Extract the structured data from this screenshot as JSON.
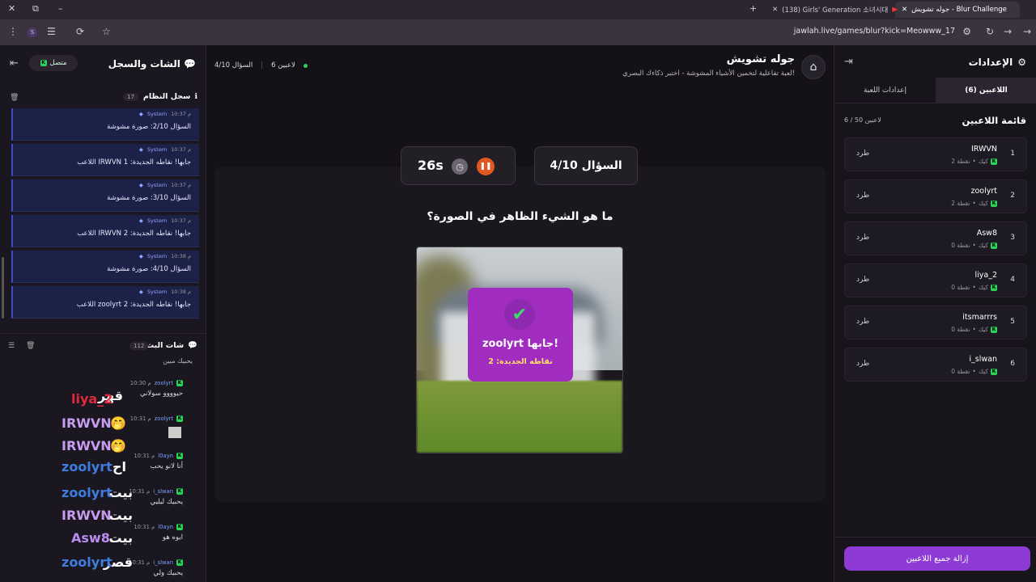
{
  "browser": {
    "tabs": [
      {
        "label": "جوله تشويش - Blur Challenge",
        "active": true
      },
      {
        "label": "(138) Girls' Generation 소녀시대",
        "active": false
      }
    ],
    "url": "jawlah.live/games/blur?kick=Meowww_17"
  },
  "settings_panel": {
    "title": "الإعدادات",
    "tabs": [
      "اللاعبين (6)",
      "إعدادات اللعبة"
    ],
    "players_title": "قائمة اللاعبين",
    "players_count": "6 / 50 لاعبين",
    "platform_label": "كيك",
    "kick_label": "طرد",
    "players": [
      {
        "rank": "1",
        "name": "IRWVN",
        "points": "2 نقطة"
      },
      {
        "rank": "2",
        "name": "zoolyrt",
        "points": "2 نقطة"
      },
      {
        "rank": "3",
        "name": "Asw8",
        "points": "0 نقطة"
      },
      {
        "rank": "4",
        "name": "liya_2",
        "points": "0 نقطة"
      },
      {
        "rank": "5",
        "name": "itsmarrrs",
        "points": "0 نقطة"
      },
      {
        "rank": "6",
        "name": "i_slwan",
        "points": "0 نقطة"
      }
    ],
    "clear_button": "إزالة جميع اللاعبين"
  },
  "game": {
    "title": "جوله تشويش",
    "subtitle": "لعبة تفاعلية لتخمين الأشياء المشوشة - اختبر ذكاءك البصري!",
    "players_online": "6 لاعبين",
    "question_short": "السؤال 4/10",
    "question_box": "السؤال 4/10",
    "timer": "26s",
    "question_text": "ما هو الشيء الظاهر في الصورة؟",
    "overlay_title": "zoolyrt جابها!",
    "overlay_sub": "نقاطه الجديدة: 2"
  },
  "chat_panel": {
    "title": "الشات والسجل",
    "status": "متصل",
    "system_log": {
      "title": "سجل النظام",
      "count": "17",
      "sender": "System",
      "messages": [
        {
          "time": "10:37 م",
          "text": "السؤال 2/10: صورة مشوشة"
        },
        {
          "time": "10:37 م",
          "text": "اللاعب IRWVN جابها! نقاطه الجديدة: 1"
        },
        {
          "time": "10:37 م",
          "text": "السؤال 3/10: صورة مشوشة"
        },
        {
          "time": "10:37 م",
          "text": "اللاعب IRWVN جابها! نقاطه الجديدة: 2"
        },
        {
          "time": "10:38 م",
          "text": "السؤال 4/10: صورة مشوشة"
        },
        {
          "time": "10:38 م",
          "text": "اللاعب zoolyrt جابها! نقاطه الجديدة: 2"
        }
      ]
    },
    "live_chat": {
      "title": "شات البث",
      "count": "112",
      "partial_top": "يحبيك مبين",
      "messages": [
        {
          "user": "zoolyrt",
          "time": "10:30 م",
          "text": "حيوووو سولاني",
          "big": "قهر",
          "big_user": "liya_2",
          "big_color": "#e02a3a"
        },
        {
          "user": "zoolyrt",
          "time": "10:31 م",
          "text": "",
          "big": "🤭",
          "big_user": "IRWVN",
          "big_color": "#c89cf0"
        },
        {
          "user": "",
          "time": "",
          "text": "",
          "big": "🤭",
          "big_user": "IRWVN",
          "big_color": "#c89cf0"
        },
        {
          "user": "l0ayn",
          "time": "10:31 م",
          "text": "أنا لانو يحب",
          "big": "اح",
          "big_user": "zoolyrt",
          "big_color": "#3d7de0"
        },
        {
          "user": "i_slwan",
          "time": "10:31 م",
          "text": "يحبيك ليليي",
          "big": "بيت",
          "big_user": "zoolyrt",
          "big_color": "#3d7de0"
        },
        {
          "user": "",
          "time": "",
          "text": "",
          "big": "بيت",
          "big_user": "IRWVN",
          "big_color": "#c89cf0"
        },
        {
          "user": "l0ayn",
          "time": "10:31 م",
          "text": "ايوه هو",
          "big": "بيت",
          "big_user": "Asw8",
          "big_color": "#b88cf0"
        },
        {
          "user": "i_slwan",
          "time": "10:31 م",
          "text": "يحبيك ولي",
          "big": "قصر",
          "big_user": "zoolyrt",
          "big_color": "#3d7de0"
        }
      ]
    }
  }
}
